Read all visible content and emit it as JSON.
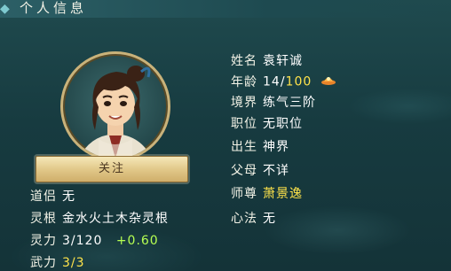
{
  "header": {
    "title": "个人信息"
  },
  "portrait": {
    "icon": "character-portrait"
  },
  "follow_button": {
    "label": "关注"
  },
  "info": {
    "name": {
      "label": "姓名",
      "value": "袁轩诚"
    },
    "age": {
      "label": "年龄",
      "current": "14",
      "max": "100",
      "icon": "lifespan-icon"
    },
    "realm": {
      "label": "境界",
      "value": "练气三阶"
    },
    "position": {
      "label": "职位",
      "value": "无职位"
    },
    "birthplace": {
      "label": "出生",
      "value": "神界"
    },
    "parents": {
      "label": "父母",
      "value": "不详"
    },
    "master": {
      "label": "师尊",
      "value": "萧景逸"
    },
    "technique": {
      "label": "心法",
      "value": "无"
    },
    "partner": {
      "label": "道侣",
      "value": "无"
    },
    "spirit_root": {
      "label": "灵根",
      "value": "金水火土木杂灵根"
    },
    "spirit_power": {
      "label": "灵力",
      "value": "3/120",
      "rate": "+0.60"
    },
    "martial": {
      "label": "武力",
      "value": "3/3"
    }
  },
  "colors": {
    "highlight": "#ffe34a",
    "rate": "#b6ff52",
    "button": "#e2c98a"
  }
}
